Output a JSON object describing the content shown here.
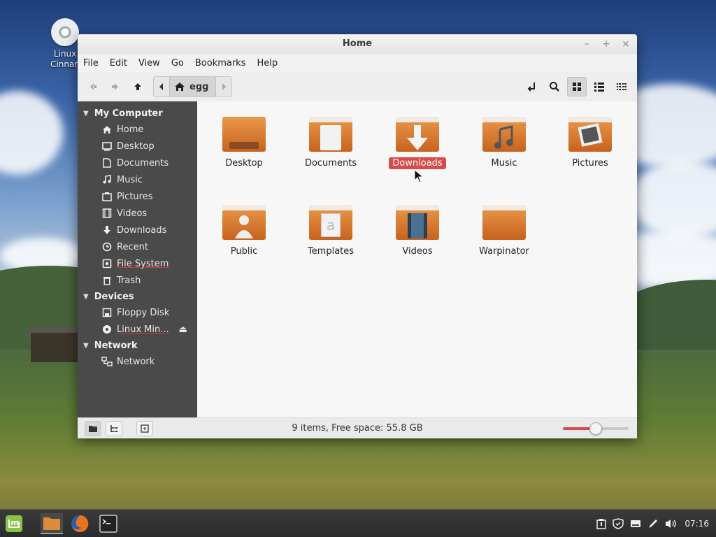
{
  "desktop": {
    "icon_label_line1": "Linux",
    "icon_label_line2": "Cinnam"
  },
  "window": {
    "title": "Home",
    "controls": [
      "–",
      "+",
      "×"
    ]
  },
  "menubar": [
    "File",
    "Edit",
    "View",
    "Go",
    "Bookmarks",
    "Help"
  ],
  "toolbar": {
    "path_crumb": "egg",
    "icons": [
      "back-icon",
      "forward-icon",
      "up-icon",
      "open-terminal-icon",
      "search-icon",
      "icon-view-icon",
      "list-view-icon",
      "compact-view-icon"
    ]
  },
  "sidebar": {
    "sections": [
      {
        "title": "My Computer",
        "items": [
          {
            "label": "Home",
            "icon": "home-icon"
          },
          {
            "label": "Desktop",
            "icon": "desktop-icon"
          },
          {
            "label": "Documents",
            "icon": "documents-icon"
          },
          {
            "label": "Music",
            "icon": "music-icon"
          },
          {
            "label": "Pictures",
            "icon": "pictures-icon"
          },
          {
            "label": "Videos",
            "icon": "videos-icon"
          },
          {
            "label": "Downloads",
            "icon": "downloads-icon"
          },
          {
            "label": "Recent",
            "icon": "recent-icon"
          },
          {
            "label": "File System",
            "icon": "drive-icon"
          },
          {
            "label": "Trash",
            "icon": "trash-icon"
          }
        ]
      },
      {
        "title": "Devices",
        "items": [
          {
            "label": "Floppy Disk",
            "icon": "floppy-icon"
          },
          {
            "label": "Linux Min...",
            "icon": "disc-icon"
          }
        ]
      },
      {
        "title": "Network",
        "items": [
          {
            "label": "Network",
            "icon": "network-icon"
          }
        ]
      }
    ]
  },
  "files": [
    {
      "name": "Desktop",
      "selected": false
    },
    {
      "name": "Documents",
      "selected": false
    },
    {
      "name": "Downloads",
      "selected": true
    },
    {
      "name": "Music",
      "selected": false
    },
    {
      "name": "Pictures",
      "selected": false
    },
    {
      "name": "Public",
      "selected": false
    },
    {
      "name": "Templates",
      "selected": false
    },
    {
      "name": "Videos",
      "selected": false
    },
    {
      "name": "Warpinator",
      "selected": false
    }
  ],
  "statusbar": {
    "text": "9 items, Free space: 55.8 GB",
    "zoom_level": 0.5
  },
  "panel": {
    "clock": "07:16",
    "launchers": [
      "menu-icon",
      "files-icon",
      "firefox-icon",
      "terminal-icon"
    ],
    "tray": [
      "notification-icon",
      "shield-icon",
      "keyboard-icon",
      "pen-icon",
      "volume-icon"
    ]
  },
  "colors": {
    "accent": "#d94a4a",
    "folder": "#d9792f",
    "sidebar": "#4a4a4a"
  }
}
